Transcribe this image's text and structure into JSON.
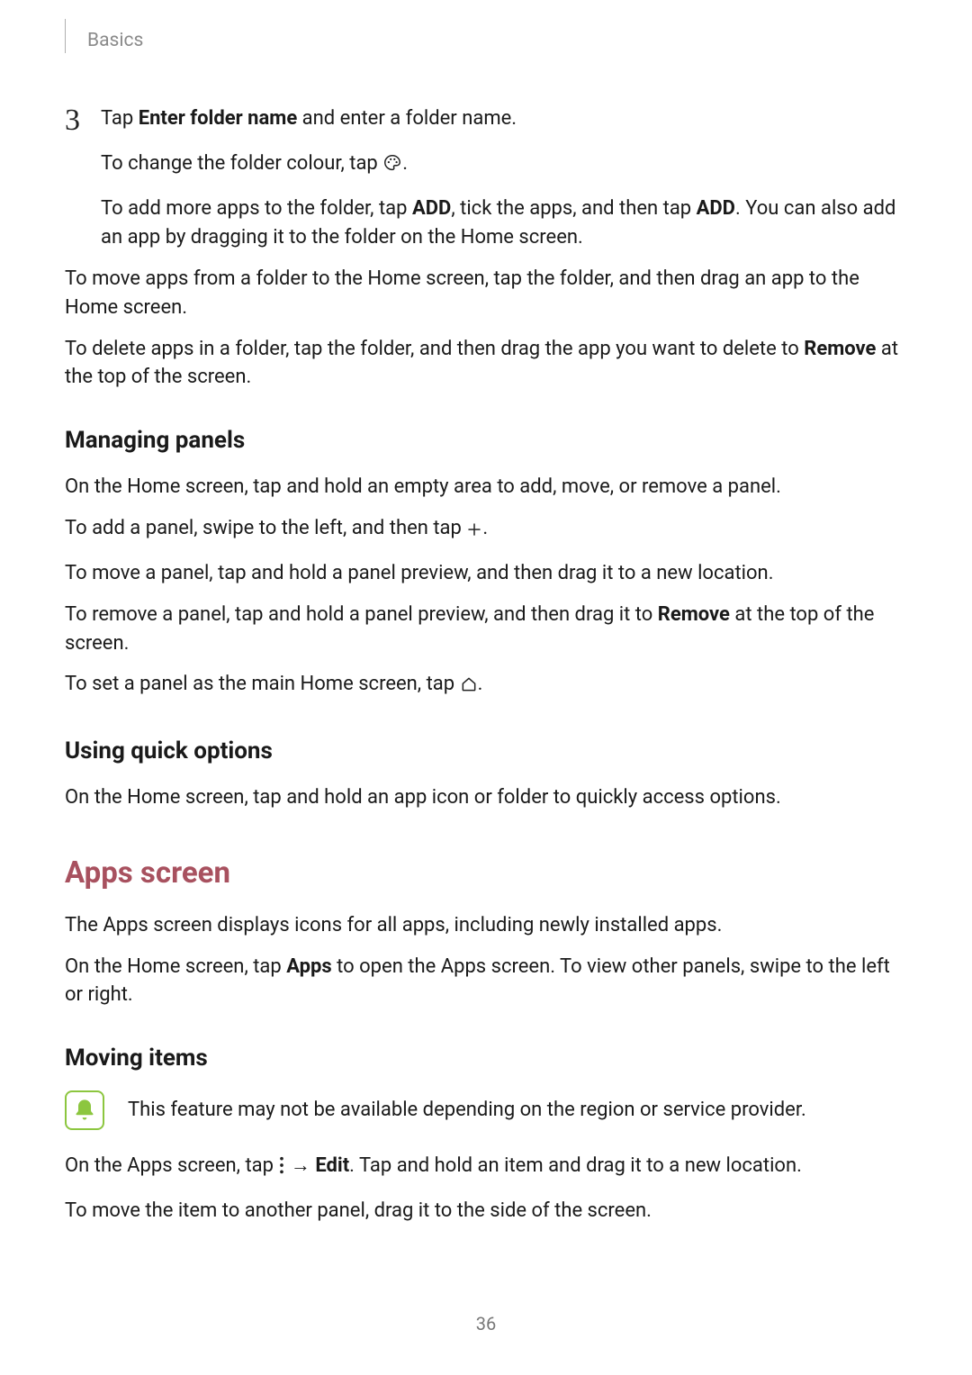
{
  "header": {
    "section": "Basics"
  },
  "step3": {
    "num": "3",
    "line1_a": "Tap ",
    "line1_b": "Enter folder name",
    "line1_c": " and enter a folder name.",
    "line2_a": "To change the folder colour, tap ",
    "line2_b": ".",
    "line3_a": "To add more apps to the folder, tap ",
    "line3_b": "ADD",
    "line3_c": ", tick the apps, and then tap ",
    "line3_d": "ADD",
    "line3_e": ". You can also add an app by dragging it to the folder on the Home screen."
  },
  "para_move": "To move apps from a folder to the Home screen, tap the folder, and then drag an app to the Home screen.",
  "para_delete_a": "To delete apps in a folder, tap the folder, and then drag the app you want to delete to ",
  "para_delete_b": "Remove",
  "para_delete_c": " at the top of the screen.",
  "managing": {
    "title": "Managing panels",
    "p1": "On the Home screen, tap and hold an empty area to add, move, or remove a panel.",
    "p2_a": "To add a panel, swipe to the left, and then tap ",
    "p2_b": ".",
    "p3": "To move a panel, tap and hold a panel preview, and then drag it to a new location.",
    "p4_a": "To remove a panel, tap and hold a panel preview, and then drag it to ",
    "p4_b": "Remove",
    "p4_c": " at the top of the screen.",
    "p5_a": "To set a panel as the main Home screen, tap ",
    "p5_b": "."
  },
  "quick": {
    "title": "Using quick options",
    "p1": "On the Home screen, tap and hold an app icon or folder to quickly access options."
  },
  "apps": {
    "title": "Apps screen",
    "p1": "The Apps screen displays icons for all apps, including newly installed apps.",
    "p2_a": "On the Home screen, tap ",
    "p2_b": "Apps",
    "p2_c": " to open the Apps screen. To view other panels, swipe to the left or right."
  },
  "moving": {
    "title": "Moving items",
    "note": "This feature may not be available depending on the region or service provider.",
    "p1_a": "On the Apps screen, tap ",
    "p1_b": " → ",
    "p1_c": "Edit",
    "p1_d": ". Tap and hold an item and drag it to a new location.",
    "p2": "To move the item to another panel, drag it to the side of the screen."
  },
  "page_number": "36"
}
